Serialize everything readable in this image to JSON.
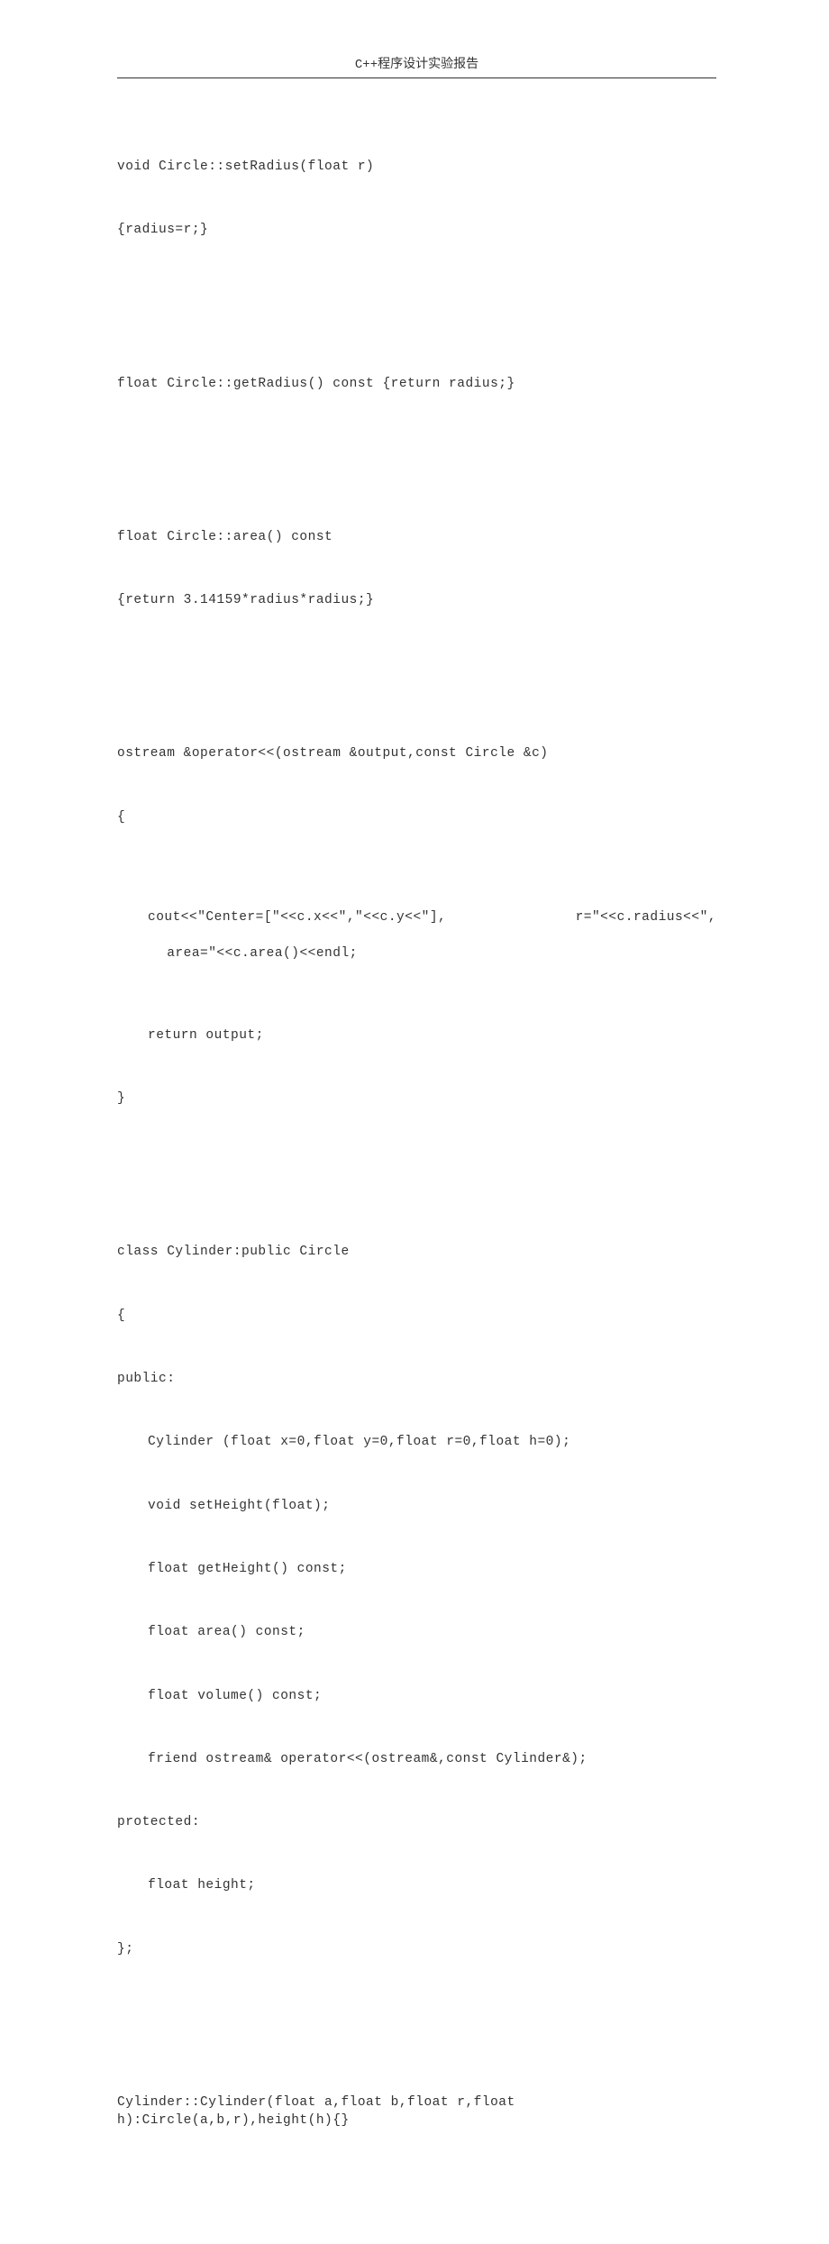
{
  "header": "C++程序设计实验报告",
  "lines": {
    "l1": "void Circle::setRadius(float r)",
    "l2": "{radius=r;}",
    "l3": "float Circle::getRadius() const {return radius;}",
    "l4": "float Circle::area() const",
    "l5": "{return 3.14159*radius*radius;}",
    "l6": "ostream &operator<<(ostream &output,const Circle &c)",
    "l7": "{",
    "l8a": "cout<<\"Center=[\"<<c.x<<\",\"<<c.y<<\"],",
    "l8b": "r=\"<<c.radius<<\",",
    "l8c": "area=\"<<c.area()<<endl;",
    "l9": "return output;",
    "l10": "}",
    "l11": "class Cylinder:public Circle",
    "l12": "{",
    "l13": "public:",
    "l14": "Cylinder (float x=0,float y=0,float r=0,float h=0);",
    "l15": "void setHeight(float);",
    "l16": "float getHeight() const;",
    "l17": "float area() const;",
    "l18": "float volume() const;",
    "l19": "friend ostream& operator<<(ostream&,const Cylinder&);",
    "l20": "protected:",
    "l21": "float height;",
    "l22": "};",
    "l23": "Cylinder::Cylinder(float a,float b,float r,float h):Circle(a,b,r),height(h){}"
  }
}
